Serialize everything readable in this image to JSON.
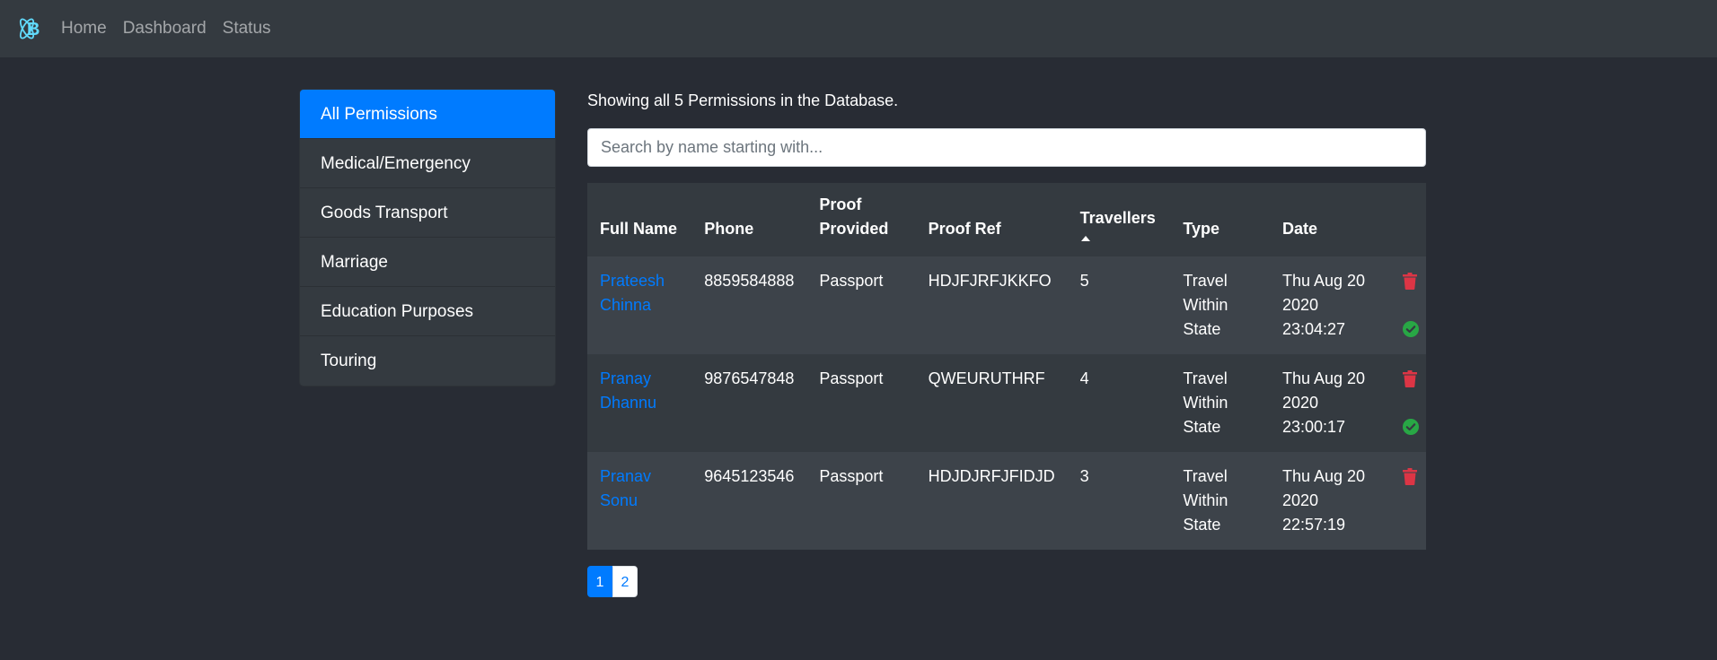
{
  "navbar": {
    "links": [
      "Home",
      "Dashboard",
      "Status"
    ],
    "logo_icon": "react-bootstrap-logo-icon"
  },
  "sidebar": {
    "items": [
      {
        "label": "All Permissions",
        "active": true
      },
      {
        "label": "Medical/Emergency",
        "active": false
      },
      {
        "label": "Goods Transport",
        "active": false
      },
      {
        "label": "Marriage",
        "active": false
      },
      {
        "label": "Education Purposes",
        "active": false
      },
      {
        "label": "Touring",
        "active": false
      }
    ]
  },
  "main": {
    "count_text": "Showing all 5 Permissions in the Database.",
    "search_placeholder": "Search by name starting with...",
    "search_value": ""
  },
  "table": {
    "headers": [
      "Full Name",
      "Phone",
      "Proof Provided",
      "Proof Ref",
      "Travellers",
      "Type",
      "Date"
    ],
    "sorted_column": "Travellers",
    "rows": [
      {
        "name": "Prateesh Chinna",
        "phone": "8859584888",
        "proof": "Passport",
        "ref": "HDJFJRFJKKFO",
        "travellers": "5",
        "type": "Travel Within State",
        "date": "Thu Aug 20 2020 23:04:27",
        "approved": true
      },
      {
        "name": "Pranay Dhannu",
        "phone": "9876547848",
        "proof": "Passport",
        "ref": "QWEURUTHRF",
        "travellers": "4",
        "type": "Travel Within State",
        "date": "Thu Aug 20 2020 23:00:17",
        "approved": true
      },
      {
        "name": "Pranav Sonu",
        "phone": "9645123546",
        "proof": "Passport",
        "ref": "HDJDJRFJFIDJD",
        "travellers": "3",
        "type": "Travel Within State",
        "date": "Thu Aug 20 2020 22:57:19",
        "approved": false
      }
    ]
  },
  "pagination": {
    "pages": [
      "1",
      "2"
    ],
    "current": "1"
  },
  "colors": {
    "accent": "#007bff",
    "delete": "#dc3545",
    "approved": "#28a745",
    "background": "#282c34",
    "navbar": "#343a40"
  }
}
